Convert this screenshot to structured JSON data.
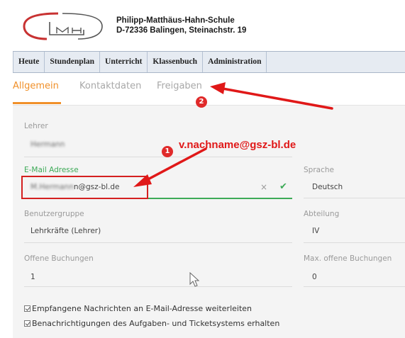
{
  "header": {
    "school_name": "Philipp-Matthäus-Hahn-Schule",
    "school_address": "D-72336 Balingen, Steinachstr. 19"
  },
  "nav": [
    "Heute",
    "Stundenplan",
    "Unterricht",
    "Klassenbuch",
    "Administration"
  ],
  "tabs": {
    "items": [
      "Allgemein",
      "Kontaktdaten",
      "Freigaben"
    ],
    "active": "Allgemein"
  },
  "form": {
    "lehrer": {
      "label": "Lehrer",
      "value": "Hermann"
    },
    "email": {
      "label": "E-Mail Adresse",
      "value_hidden": "M.Hermann",
      "value_visible": "n@gsz-bl.de",
      "valid": true
    },
    "sprache": {
      "label": "Sprache",
      "value": "Deutsch"
    },
    "benutzergruppe": {
      "label": "Benutzergruppe",
      "value": "Lehrkräfte (Lehrer)"
    },
    "abteilung": {
      "label": "Abteilung",
      "value": "IV"
    },
    "offene_buchungen": {
      "label": "Offene Buchungen",
      "value": "1"
    },
    "max_offene_buchungen": {
      "label": "Max. offene Buchungen",
      "value": "0"
    }
  },
  "checkboxes": [
    {
      "label": "Empfangene Nachrichten an E-Mail-Adresse weiterleiten",
      "checked": true
    },
    {
      "label": "Benachrichtigungen des Aufgaben- und Ticketsystems erhalten",
      "checked": true
    }
  ],
  "annotations": {
    "email_hint": "v.nachname@gsz-bl.de",
    "badge_1": "1",
    "badge_2": "2"
  },
  "icons": {
    "clear": "×",
    "valid": "✔"
  },
  "colors": {
    "accent": "#f0902a",
    "valid_green": "#3daa57",
    "annotation_red": "#e01818",
    "nav_bg": "#e6ebf2"
  }
}
